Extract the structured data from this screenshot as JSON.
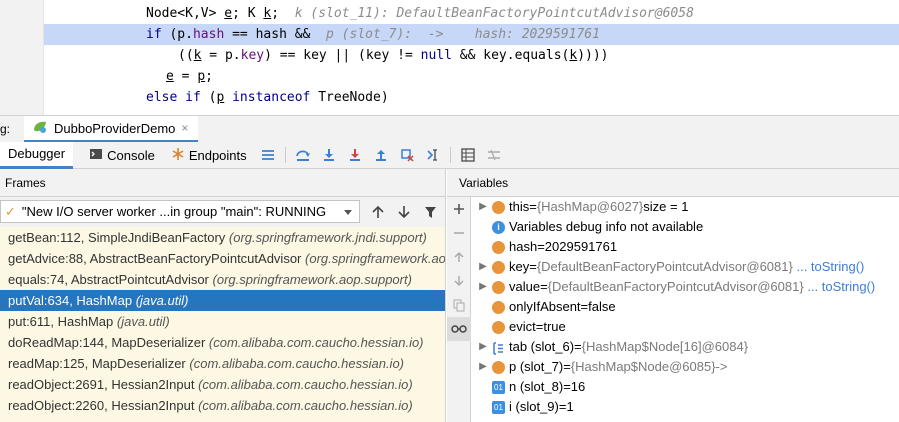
{
  "editor": {
    "line1_code": "Node<K,V> ",
    "line1_e": "e",
    "line1_mid": "; K ",
    "line1_k": "k",
    "line1_semi": ";",
    "line1_hint": "k (slot_11): DefaultBeanFactoryPointcutAdvisor@6058",
    "line2_if": "if",
    "line2_a": " (p.",
    "line2_hash": "hash",
    "line2_b": " == hash &&",
    "line2_hint": "p (slot_7):  ->    hash: 2029591761",
    "line3_a": "((",
    "line3_k": "k",
    "line3_b": " = p.",
    "line3_key": "key",
    "line3_c": ") == key || (key != ",
    "line3_null": "null",
    "line3_d": " && key.equals(",
    "line3_k2": "k",
    "line3_e": "))))",
    "line4_e": "e",
    "line4_b": " = ",
    "line4_p": "p",
    "line4_c": ";",
    "line5_else": "else if",
    "line5_a": " (",
    "line5_p": "p",
    "line5_b": " ",
    "line5_instanceof": "instanceof",
    "line5_c": " TreeNode)"
  },
  "debug_header": {
    "prefix": "g:",
    "session_tab": "DubboProviderDemo"
  },
  "toolbar": {
    "tabs": [
      {
        "label": "Debugger"
      },
      {
        "label": "Console"
      },
      {
        "label": "Endpoints"
      }
    ]
  },
  "frames": {
    "title": "Frames",
    "thread": "\"New I/O server worker ...in group \"main\": RUNNING",
    "items": [
      {
        "method": "getBean:112, SimpleJndiBeanFactory",
        "pkg": "(org.springframework.jndi.support)"
      },
      {
        "method": "getAdvice:88, AbstractBeanFactoryPointcutAdvisor",
        "pkg": "(org.springframework.ao"
      },
      {
        "method": "equals:74, AbstractPointcutAdvisor",
        "pkg": "(org.springframework.aop.support)"
      },
      {
        "method": "putVal:634, HashMap",
        "pkg": "(java.util)"
      },
      {
        "method": "put:611, HashMap",
        "pkg": "(java.util)"
      },
      {
        "method": "doReadMap:144, MapDeserializer",
        "pkg": "(com.alibaba.com.caucho.hessian.io)"
      },
      {
        "method": "readMap:125, MapDeserializer",
        "pkg": "(com.alibaba.com.caucho.hessian.io)"
      },
      {
        "method": "readObject:2691, Hessian2Input",
        "pkg": "(com.alibaba.com.caucho.hessian.io)"
      },
      {
        "method": "readObject:2260, Hessian2Input",
        "pkg": "(com.alibaba.com.caucho.hessian.io)"
      }
    ]
  },
  "variables": {
    "title": "Variables",
    "items": [
      {
        "name": "this",
        "eq": " = ",
        "ref": "{HashMap@6027}",
        "extra": "  size = 1",
        "link": ""
      },
      {
        "name": "Variables debug info not available",
        "eq": "",
        "ref": "",
        "extra": "",
        "link": ""
      },
      {
        "name": "hash",
        "eq": " = ",
        "ref": "",
        "extra": "2029591761",
        "link": ""
      },
      {
        "name": "key",
        "eq": " = ",
        "ref": "{DefaultBeanFactoryPointcutAdvisor@6081}",
        "extra": "",
        "link": "... toString()"
      },
      {
        "name": "value",
        "eq": " = ",
        "ref": "{DefaultBeanFactoryPointcutAdvisor@6081}",
        "extra": "",
        "link": "... toString()"
      },
      {
        "name": "onlyIfAbsent",
        "eq": " = ",
        "ref": "",
        "extra": "false",
        "link": ""
      },
      {
        "name": "evict",
        "eq": " = ",
        "ref": "",
        "extra": "true",
        "link": ""
      },
      {
        "name": "tab (slot_6)",
        "eq": " = ",
        "ref": "{HashMap$Node[16]@6084}",
        "extra": "",
        "link": ""
      },
      {
        "name": "p (slot_7)",
        "eq": " = ",
        "ref": "{HashMap$Node@6085}",
        "extra": "  ->",
        "link": ""
      },
      {
        "name": "n (slot_8)",
        "eq": " = ",
        "ref": "",
        "extra": "16",
        "link": ""
      },
      {
        "name": "i (slot_9)",
        "eq": " = ",
        "ref": "",
        "extra": "1",
        "link": ""
      }
    ]
  },
  "colors": {
    "highlight_line": "#c6d7f7",
    "selected_frame": "#2675bf",
    "frames_background": "#fcf8e4",
    "accent": "#4083c9"
  }
}
